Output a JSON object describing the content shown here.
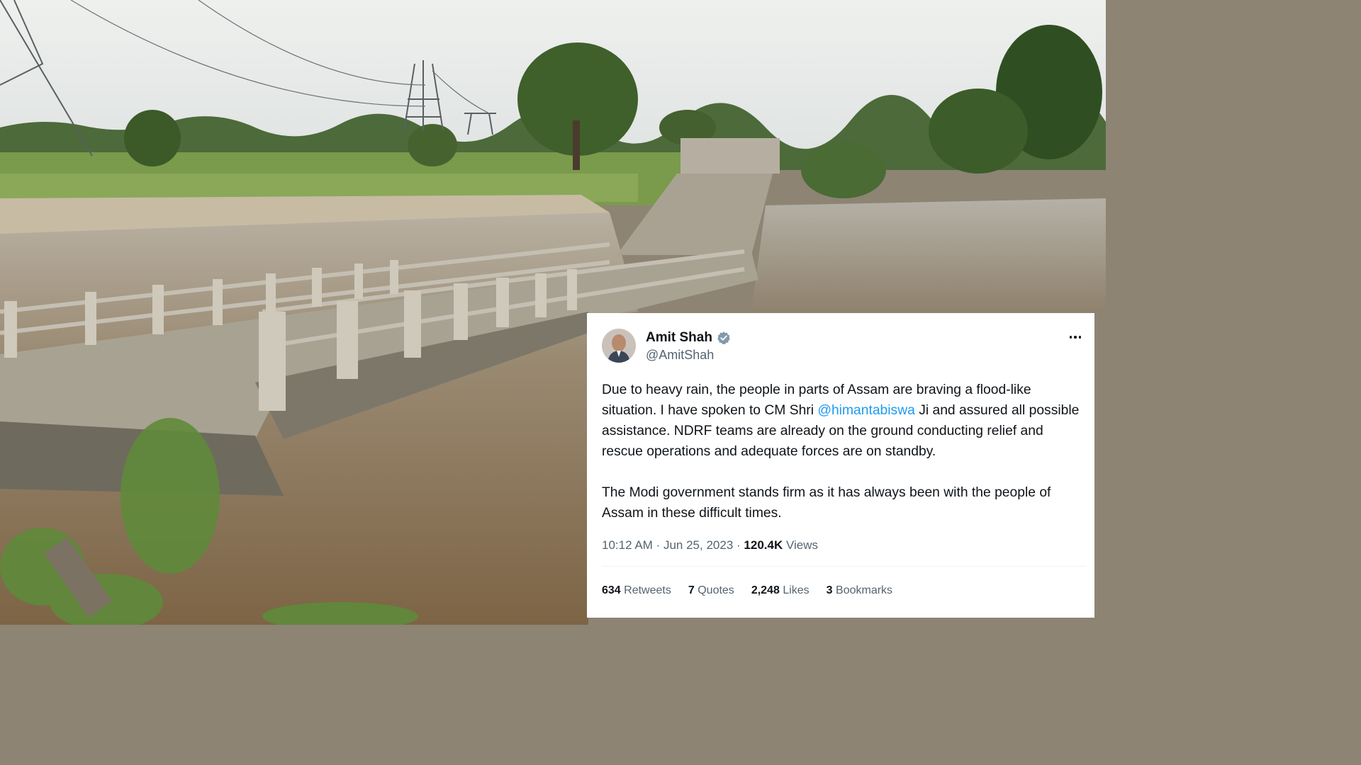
{
  "tweet": {
    "author_name": "Amit Shah",
    "author_handle": "@AmitShah",
    "paragraph1_prefix": "Due to heavy rain, the people in parts of Assam are braving a flood-like situation. I have spoken to CM Shri ",
    "mention": "@himantabiswa",
    "paragraph1_suffix": " Ji and assured all possible assistance. NDRF teams are already on the ground conducting relief and rescue operations and adequate forces are on standby.",
    "paragraph2": "The Modi government stands firm as it has always been with the people of Assam in these difficult times.",
    "time": "10:12 AM",
    "date": "Jun 25, 2023",
    "views_count": "120.4K",
    "views_label": "Views",
    "separator": "·",
    "stats": {
      "retweets_count": "634",
      "retweets_label": "Retweets",
      "quotes_count": "7",
      "quotes_label": "Quotes",
      "likes_count": "2,248",
      "likes_label": "Likes",
      "bookmarks_count": "3",
      "bookmarks_label": "Bookmarks"
    }
  },
  "colors": {
    "link_blue": "#1d9bf0",
    "verified_badge": "#829aab",
    "text_primary": "#0f1419",
    "text_secondary": "#536471",
    "flood_water": "#7d6445"
  },
  "icons": [
    "verified-badge-icon",
    "more-options-icon"
  ]
}
